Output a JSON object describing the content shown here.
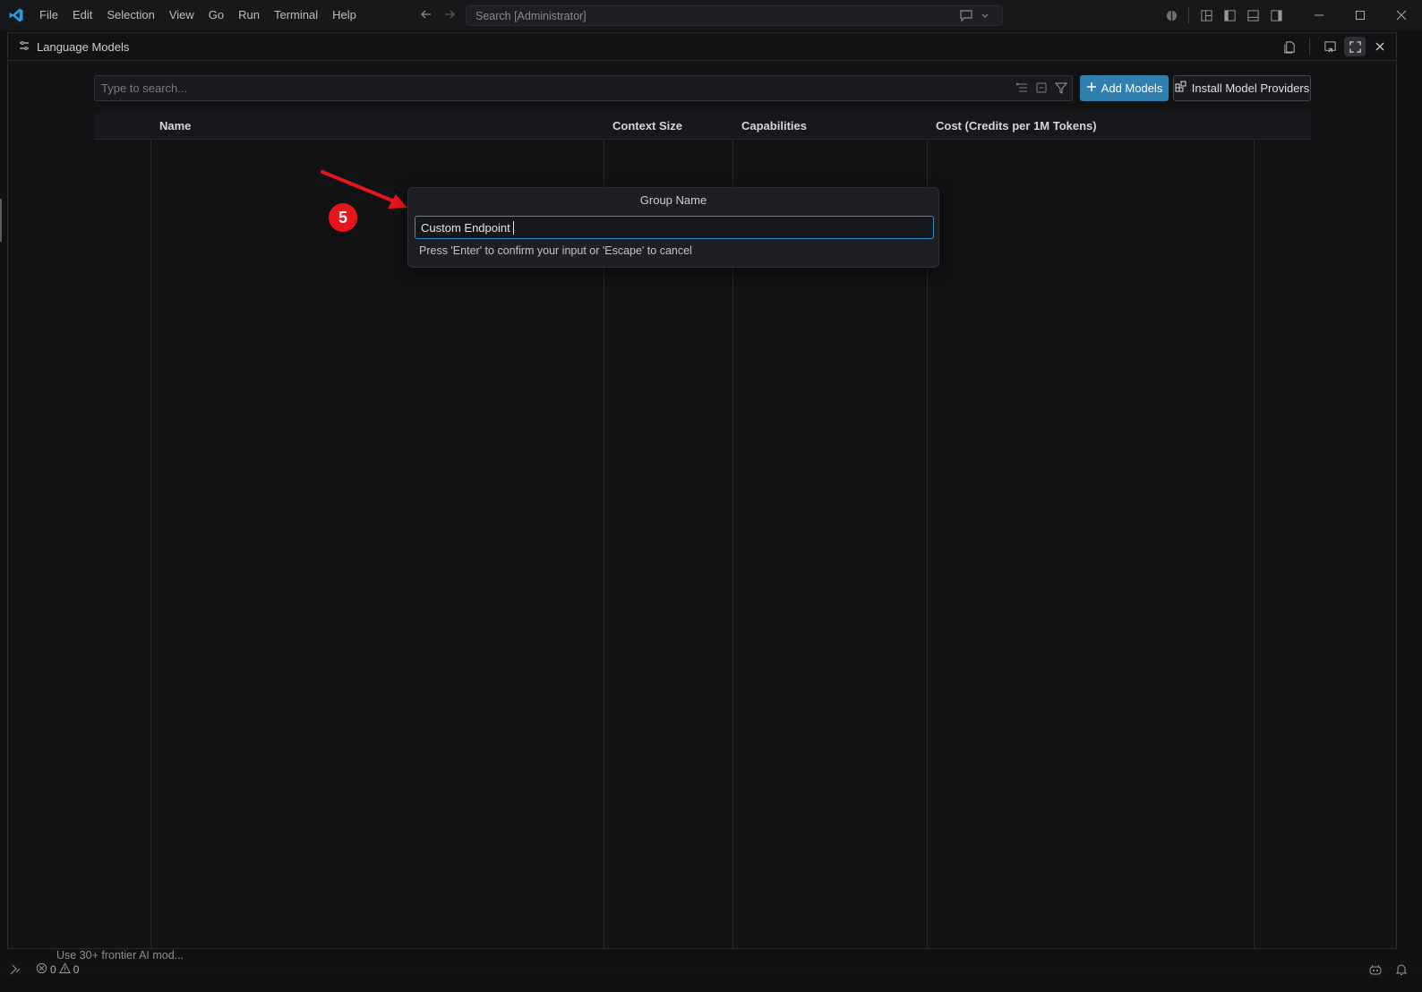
{
  "menubar": {
    "items": [
      "File",
      "Edit",
      "Selection",
      "View",
      "Go",
      "Run",
      "Terminal",
      "Help"
    ],
    "command_center": "Search [Administrator]"
  },
  "panel": {
    "title": "Language Models"
  },
  "toolbar": {
    "search_placeholder": "Type to search...",
    "add_models_label": "Add Models",
    "install_providers_label": "Install Model Providers"
  },
  "table": {
    "columns": [
      "Name",
      "Context Size",
      "Capabilities",
      "Cost (Credits per 1M Tokens)"
    ]
  },
  "quick_input": {
    "title": "Group Name",
    "value": "Custom Endpoint",
    "hint": "Press 'Enter' to confirm your input or 'Escape' to cancel"
  },
  "annotation": {
    "step": "5"
  },
  "statusbar": {
    "hidden_text": "Use 30+ frontier AI mod...",
    "errors": "0",
    "warnings": "0"
  },
  "colors": {
    "accent": "#2f7fb0",
    "focus_border": "#3a8fc8",
    "annotation_red": "#e8151b"
  }
}
